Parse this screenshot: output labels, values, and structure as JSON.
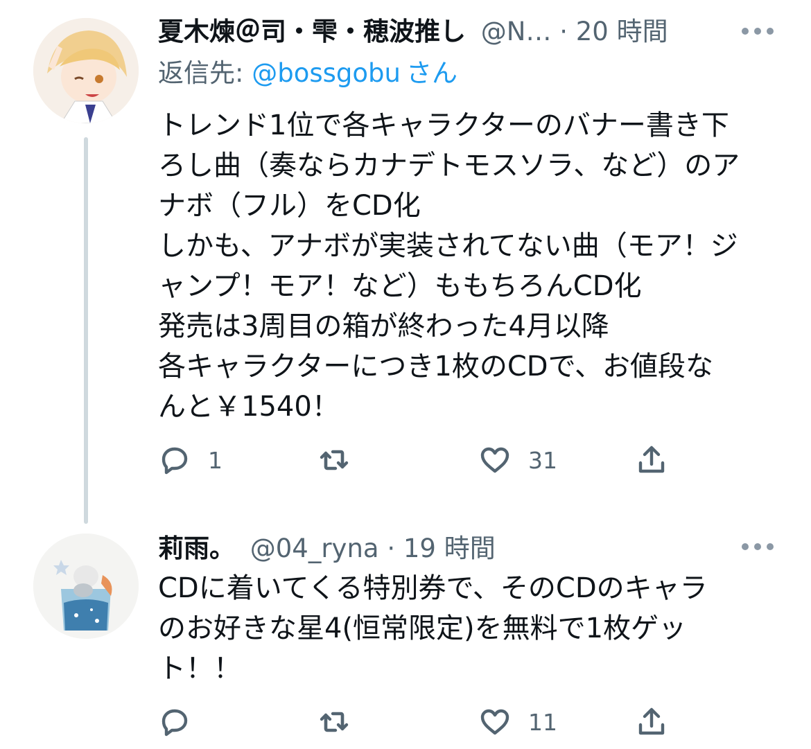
{
  "tweets": [
    {
      "author": "夏木煉＠司・雫・穂波推し",
      "handle": "@N…",
      "separator": "·",
      "time": "20 時間",
      "reply_label": "返信先: ",
      "reply_mention": "@bossgobu",
      "reply_suffix": "さん",
      "text": "トレンド1位で各キャラクターのバナー書き下\nろし曲（奏ならカナデトモスソラ、など）のア\nナボ（フル）をCD化\nしかも、アナボが実装されてない曲（モア！ジ\nャンプ！モア！など）ももちろんCD化\n発売は3周目の箱が終わった4月以降\n各キャラクターにつき1枚のCDで、お値段な\nんと￥1540！",
      "replies": "1",
      "retweets": "",
      "likes": "31"
    },
    {
      "author": "莉雨。",
      "handle": "@04_ryna",
      "separator": "·",
      "time": "19 時間",
      "text": "CDに着いてくる特別券で、そのCDのキャラ\nのお好きな星4(恒常限定)を無料で1枚ゲッ\nト！！",
      "replies": "",
      "retweets": "",
      "likes": "11"
    }
  ],
  "colors": {
    "text": "#0f1419",
    "secondary": "#536471",
    "link": "#1d9bf0",
    "thread_line": "#cfd9de"
  },
  "icons": [
    "reply-icon",
    "retweet-icon",
    "like-icon",
    "share-icon",
    "more-icon"
  ]
}
